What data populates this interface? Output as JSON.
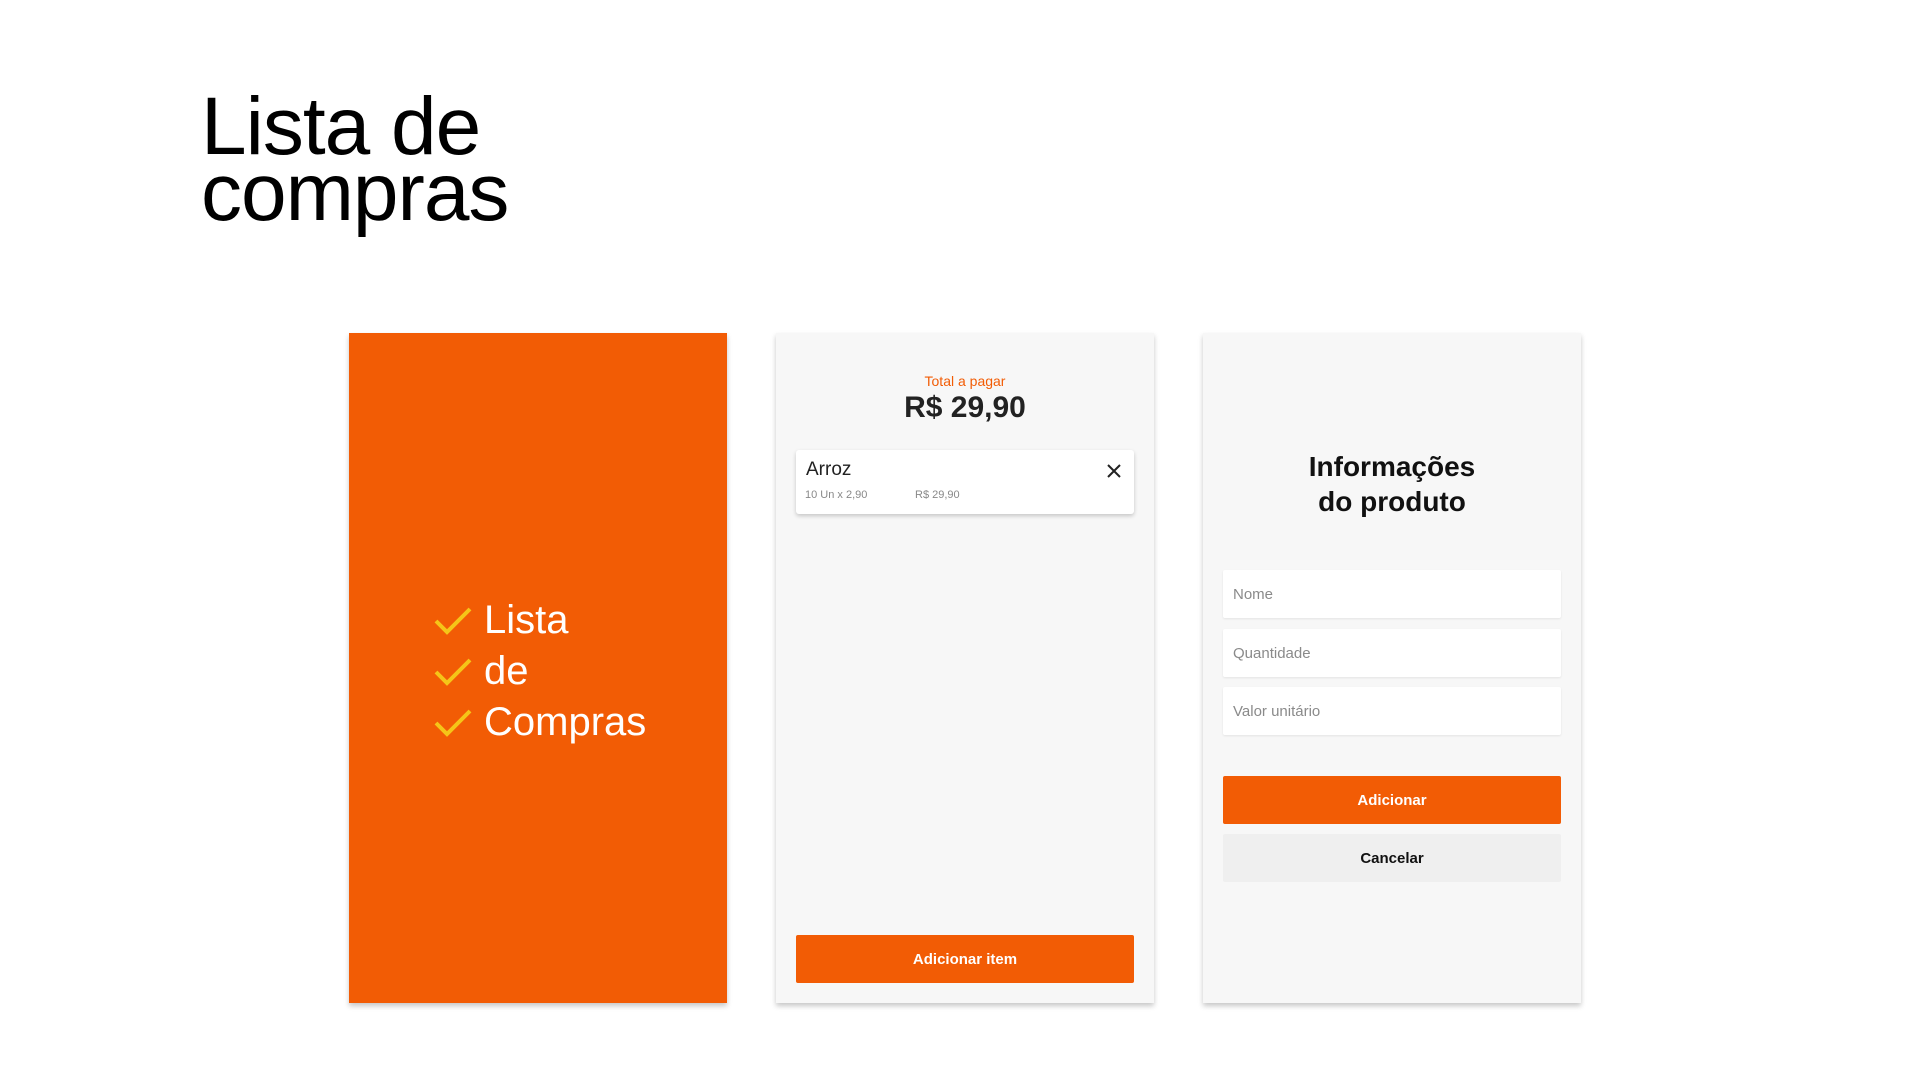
{
  "page": {
    "title_line1": "Lista de",
    "title_line2": "compras"
  },
  "colors": {
    "brand": "#f25c05",
    "check": "#f5c518",
    "screen_bg": "#f7f7f7"
  },
  "splash": {
    "items": [
      {
        "icon": "check-icon",
        "label": "Lista"
      },
      {
        "icon": "check-icon",
        "label": "de"
      },
      {
        "icon": "check-icon",
        "label": "Compras"
      }
    ]
  },
  "list_screen": {
    "total_label": "Total a pagar",
    "total_value": "R$ 29,90",
    "items": [
      {
        "name": "Arroz",
        "qty_detail": "10 Un x 2,90",
        "price": "R$ 29,90",
        "remove_icon": "close-icon"
      }
    ],
    "add_button_label": "Adicionar item"
  },
  "form_screen": {
    "title_line1": "Informações",
    "title_line2": "do produto",
    "fields": {
      "name_placeholder": "Nome",
      "quantity_placeholder": "Quantidade",
      "unit_price_placeholder": "Valor unitário"
    },
    "add_button_label": "Adicionar",
    "cancel_button_label": "Cancelar"
  }
}
